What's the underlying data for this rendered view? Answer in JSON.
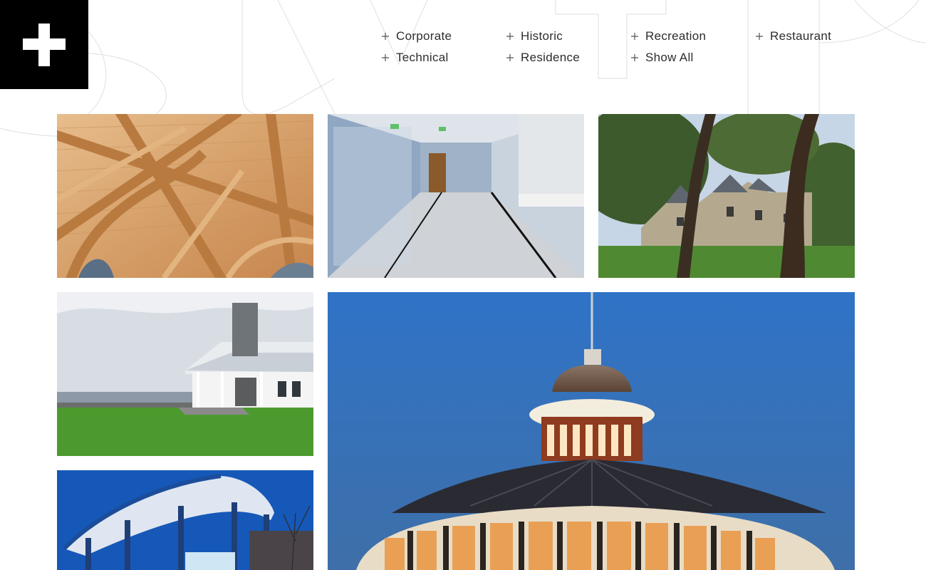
{
  "brand": {
    "logo_icon": "plus-logo-icon",
    "logo_bg": "#000000",
    "logo_fg": "#ffffff"
  },
  "nav": {
    "icon": "plus-icon",
    "items": [
      {
        "label": "Corporate"
      },
      {
        "label": "Historic"
      },
      {
        "label": "Recreation"
      },
      {
        "label": "Restaurant"
      },
      {
        "label": "Technical"
      },
      {
        "label": "Residence"
      },
      {
        "label": "Show All"
      }
    ]
  },
  "gallery": {
    "tiles": [
      {
        "subject": "timber-truss-ceiling"
      },
      {
        "subject": "hospital-corridor"
      },
      {
        "subject": "stone-house-with-trees"
      },
      {
        "subject": "waterfront-porch-with-chimney"
      },
      {
        "subject": "domed-rotunda-at-dusk"
      },
      {
        "subject": "glass-pavilion-at-dusk"
      }
    ]
  }
}
